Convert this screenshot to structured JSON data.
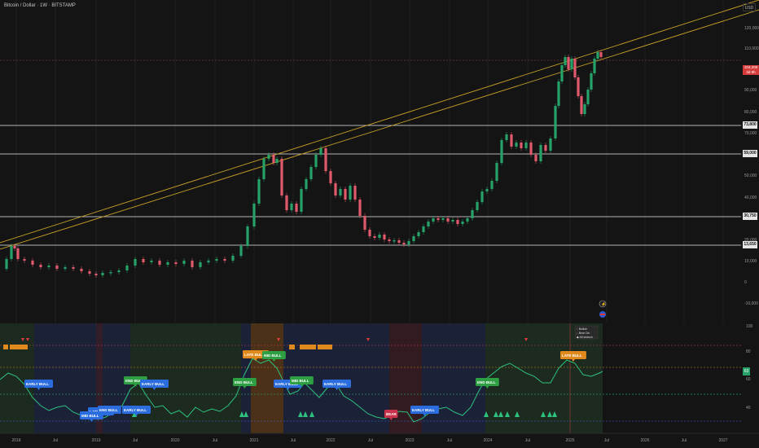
{
  "header": {
    "symbol_title": "Bitcoin / Dollar · 1W · BITSTAMP",
    "currency_button": "USD"
  },
  "price_axis": {
    "ticks": [
      "120,000",
      "110,000",
      "100,000",
      "90,000",
      "80,000",
      "70,000",
      "60,000",
      "50,000",
      "40,000",
      "30,000",
      "20,000",
      "10,000",
      "0",
      "-10,000"
    ]
  },
  "level_tags": {
    "l1": "73,800",
    "l2": "59,000",
    "l3": "30,750",
    "l4": "13,650"
  },
  "last_price": {
    "value": "104,208",
    "sub": "3d 9h"
  },
  "indicator_axis": {
    "ticks": [
      "100",
      "80",
      "60",
      "40"
    ],
    "current": "63"
  },
  "time_axis": {
    "labels": [
      "2018",
      "Jul",
      "2019",
      "Jul",
      "2020",
      "Jul",
      "2021",
      "Jul",
      "2022",
      "Jul",
      "2023",
      "Jul",
      "2024",
      "Jul",
      "2025",
      "Jul",
      "2026",
      "Jul",
      "2027"
    ]
  },
  "labels": {
    "early_bull": "EARLY BULL",
    "late_bull": "LATE BULL",
    "end_bull": "END BULL",
    "mid_bull": "MID BULL",
    "bear": "BEAR",
    "info_box_lines": [
      "↑ Bullish",
      "↓ Bear Div",
      "◆ Alt season"
    ]
  },
  "colors": {
    "background": "#141414",
    "bull_candle": "#26a269",
    "bear_candle": "#e05a6b",
    "trendline": "#c9a227",
    "indicator_line": "#2ec27e",
    "label_blue": "#2b6cde",
    "label_green": "#2ea043",
    "label_orange": "#e08a1e",
    "label_red": "#c8324a"
  }
}
